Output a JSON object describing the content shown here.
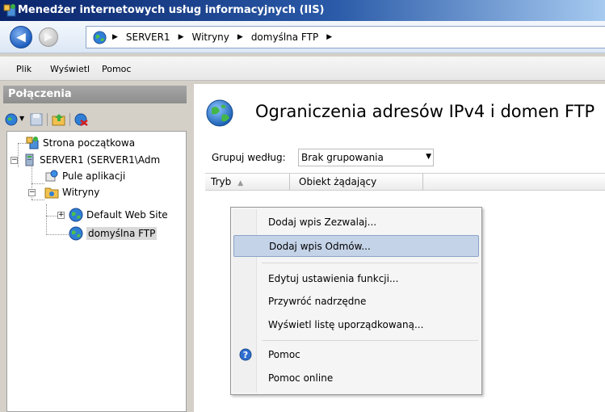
{
  "window": {
    "title": "Menedżer internetowych usług informacyjnych (IIS)"
  },
  "address": {
    "crumbs": [
      "SERVER1",
      "Witryny",
      "domyślna FTP"
    ]
  },
  "menu": {
    "file": "Plik",
    "view": "Wyświetl",
    "help": "Pomoc"
  },
  "connections": {
    "header": "Połączenia",
    "tree": [
      {
        "label": "Strona początkowa",
        "icon": "start-page-icon"
      },
      {
        "label": "SERVER1 (SERVER1\\Adm",
        "icon": "server-icon"
      },
      {
        "label": "Pule aplikacji",
        "icon": "app-pool-icon"
      },
      {
        "label": "Witryny",
        "icon": "sites-folder-icon"
      },
      {
        "label": "Default Web Site",
        "icon": "globe-icon"
      },
      {
        "label": "domyślna FTP",
        "icon": "globe-icon",
        "selected": true
      }
    ]
  },
  "main": {
    "title": "Ograniczenia adresów IPv4 i domen FTP",
    "group_label": "Grupuj według:",
    "group_value": "Brak grupowania",
    "columns": [
      "Tryb",
      "Obiekt żądający"
    ]
  },
  "context_menu": {
    "items": [
      {
        "label": "Dodaj wpis Zezwalaj..."
      },
      {
        "label": "Dodaj wpis Odmów...",
        "highlighted": true
      },
      {
        "label": "Edytuj ustawienia funkcji..."
      },
      {
        "label": "Przywróć nadrzędne"
      },
      {
        "label": "Wyświetl listę uporządkowaną..."
      },
      {
        "label": "Pomoc",
        "icon": "help-icon"
      },
      {
        "label": "Pomoc online"
      }
    ]
  },
  "colors": {
    "titlebar_start": "#0a246a",
    "titlebar_end": "#a6caf0",
    "highlight": "#c5d3e8",
    "panel_bg": "#d4d0c8"
  }
}
